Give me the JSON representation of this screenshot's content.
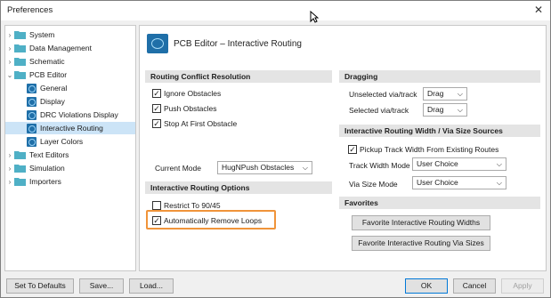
{
  "window": {
    "title": "Preferences",
    "close_glyph": "✕"
  },
  "tree": [
    {
      "label": "System",
      "expanded": false
    },
    {
      "label": "Data Management",
      "expanded": false
    },
    {
      "label": "Schematic",
      "expanded": false
    },
    {
      "label": "PCB Editor",
      "expanded": true
    },
    {
      "label": "General",
      "child": true
    },
    {
      "label": "Display",
      "child": true
    },
    {
      "label": "DRC Violations Display",
      "child": true
    },
    {
      "label": "Interactive Routing",
      "child": true,
      "selected": true
    },
    {
      "label": "Layer Colors",
      "child": true
    },
    {
      "label": "Text Editors",
      "expanded": false
    },
    {
      "label": "Simulation",
      "expanded": false
    },
    {
      "label": "Importers",
      "expanded": false
    }
  ],
  "page": {
    "title": "PCB Editor – Interactive Routing"
  },
  "routing_conflict": {
    "header": "Routing Conflict Resolution",
    "ignore": "Ignore Obstacles",
    "push": "Push Obstacles",
    "stop": "Stop At First Obstacle",
    "current_mode_label": "Current Mode",
    "current_mode_value": "HugNPush Obstacles"
  },
  "options": {
    "header": "Interactive Routing Options",
    "restrict": "Restrict To 90/45",
    "auto_remove": "Automatically Remove Loops"
  },
  "dragging": {
    "header": "Dragging",
    "unselected_label": "Unselected via/track",
    "unselected_value": "Drag",
    "selected_label": "Selected via/track",
    "selected_value": "Drag"
  },
  "width_sources": {
    "header": "Interactive Routing Width / Via Size Sources",
    "pickup": "Pickup Track Width From Existing Routes",
    "track_mode_label": "Track Width Mode",
    "track_mode_value": "User Choice",
    "via_mode_label": "Via Size Mode",
    "via_mode_value": "User Choice"
  },
  "favorites": {
    "header": "Favorites",
    "widths_button": "Favorite Interactive Routing Widths",
    "vias_button": "Favorite Interactive Routing Via Sizes"
  },
  "footer": {
    "defaults": "Set To Defaults",
    "save": "Save...",
    "load": "Load...",
    "ok": "OK",
    "cancel": "Cancel",
    "apply": "Apply"
  },
  "colors": {
    "highlight": "#f0943a",
    "selection": "#cce4f7",
    "brand": "#1f6fa8"
  }
}
